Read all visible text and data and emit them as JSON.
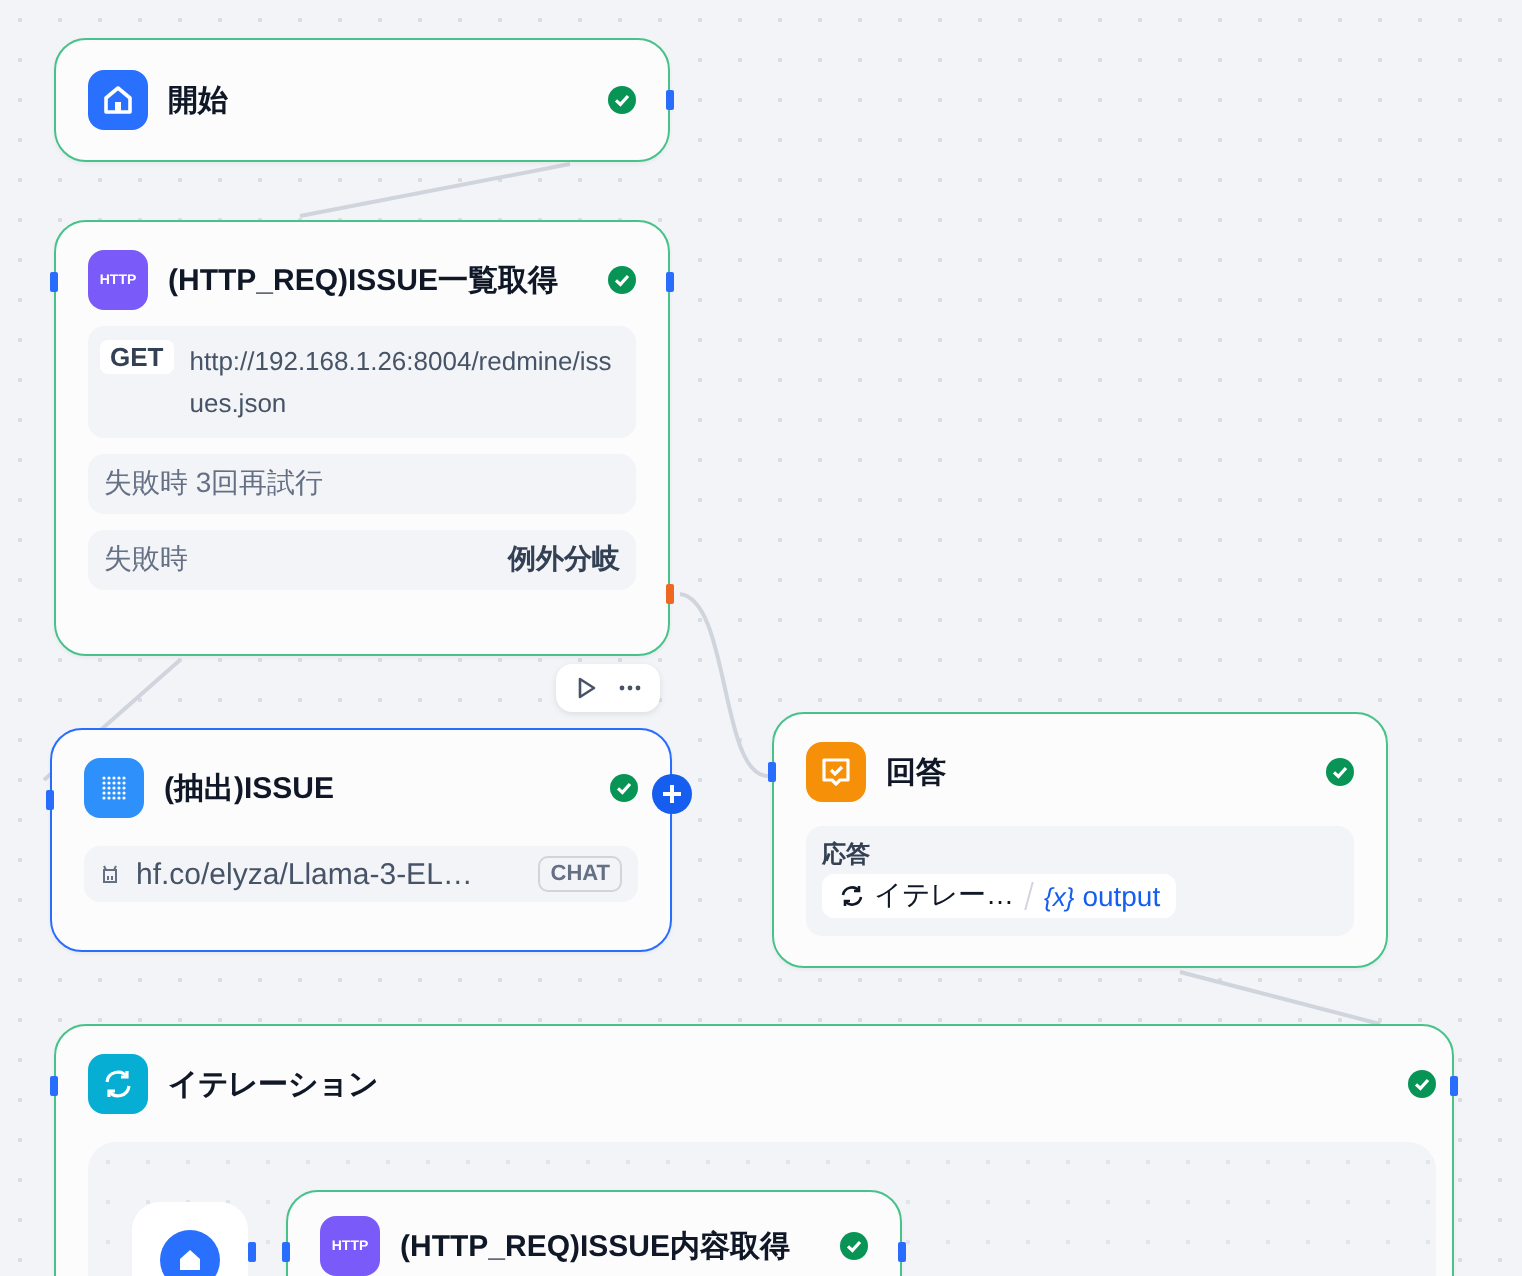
{
  "nodes": [
    {
      "kind": "start",
      "title": "開始",
      "succeeded": true,
      "selected": false
    },
    {
      "kind": "http",
      "title": "(HTTP_REQ)ISSUE一覧取得",
      "succeeded": true,
      "selected": false,
      "icon_text": "HTTP",
      "method": "GET",
      "url": "http://192.168.1.26:8004/redmine/issues.json",
      "retry": "失敗時 3回再試行",
      "error_label": "失敗時",
      "error_action": "例外分岐"
    },
    {
      "kind": "llm",
      "title": "(抽出)ISSUE",
      "succeeded": true,
      "selected": true,
      "model": "hf.co/elyza/Llama-3-EL…",
      "mode": "CHAT"
    },
    {
      "kind": "answer",
      "title": "回答",
      "succeeded": true,
      "selected": false,
      "field_label": "応答",
      "source": "イテレー…",
      "var_prefix": "{x}",
      "var_name": "output"
    },
    {
      "kind": "iteration",
      "title": "イテレーション",
      "succeeded": true,
      "selected": false,
      "children": [
        {
          "kind": "start"
        },
        {
          "kind": "http",
          "title": "(HTTP_REQ)ISSUE内容取得",
          "succeeded": true,
          "selected": false,
          "icon_text": "HTTP"
        }
      ]
    }
  ]
}
